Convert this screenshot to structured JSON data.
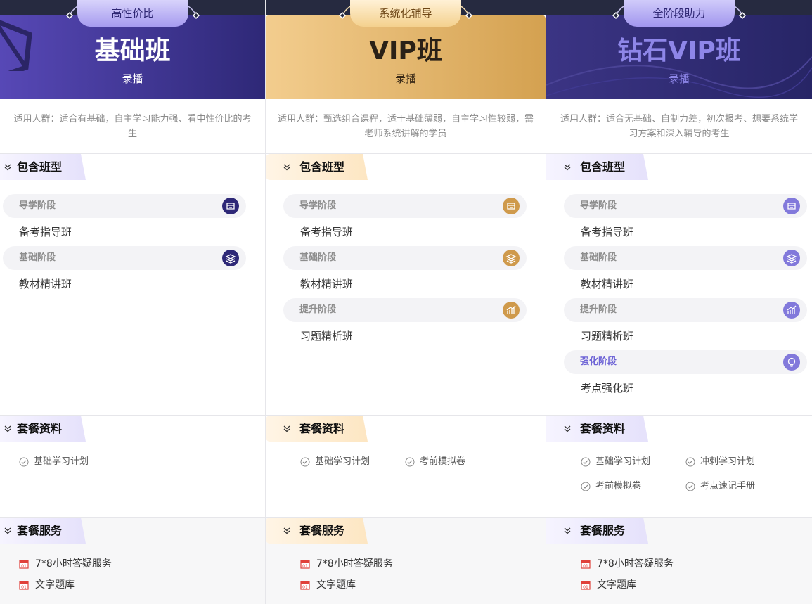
{
  "columns": [
    {
      "tag": "高性价比",
      "title": "基础班",
      "subtitle": "录播",
      "description": "适用人群：适合有基础，自主学习能力强、看中性价比的考生",
      "sections": {
        "courses_title": "包含班型",
        "materials_title": "套餐资料",
        "services_title": "套餐服务"
      },
      "stages": [
        {
          "label": "导学阶段",
          "icon": "book-icon",
          "course": "备考指导班"
        },
        {
          "label": "基础阶段",
          "icon": "layers-icon",
          "course": "教材精讲班"
        }
      ],
      "materials": [
        "基础学习计划"
      ],
      "services": [
        "7*8小时答疑服务",
        "文字题库"
      ],
      "accent": "#2e2877"
    },
    {
      "tag": "系统化辅导",
      "title": "VIP班",
      "subtitle": "录播",
      "description": "适用人群：甄选组合课程，适于基础薄弱，自主学习性较弱，需老师系统讲解的学员",
      "sections": {
        "courses_title": "包含班型",
        "materials_title": "套餐资料",
        "services_title": "套餐服务"
      },
      "stages": [
        {
          "label": "导学阶段",
          "icon": "book-icon",
          "course": "备考指导班"
        },
        {
          "label": "基础阶段",
          "icon": "layers-icon",
          "course": "教材精讲班"
        },
        {
          "label": "提升阶段",
          "icon": "chart-up-icon",
          "course": "习题精析班"
        }
      ],
      "materials": [
        "基础学习计划",
        "考前模拟卷"
      ],
      "services": [
        "7*8小时答疑服务",
        "文字题库"
      ],
      "accent": "#cf9a4c"
    },
    {
      "tag": "全阶段助力",
      "title": "钻石VIP班",
      "subtitle": "录播",
      "description": "适用人群：适合无基础、自制力差，初次报考、想要系统学习方案和深入辅导的考生",
      "sections": {
        "courses_title": "包含班型",
        "materials_title": "套餐资料",
        "services_title": "套餐服务"
      },
      "stages": [
        {
          "label": "导学阶段",
          "icon": "book-icon",
          "course": "备考指导班"
        },
        {
          "label": "基础阶段",
          "icon": "layers-icon",
          "course": "教材精讲班"
        },
        {
          "label": "提升阶段",
          "icon": "chart-up-icon",
          "course": "习题精析班"
        },
        {
          "label": "强化阶段",
          "icon": "bulb-icon",
          "course": "考点强化班"
        }
      ],
      "materials": [
        "基础学习计划",
        "冲刺学习计划",
        "考前模拟卷",
        "考点速记手册"
      ],
      "services": [
        "7*8小时答疑服务",
        "文字题库"
      ],
      "accent": "#8279db"
    }
  ]
}
